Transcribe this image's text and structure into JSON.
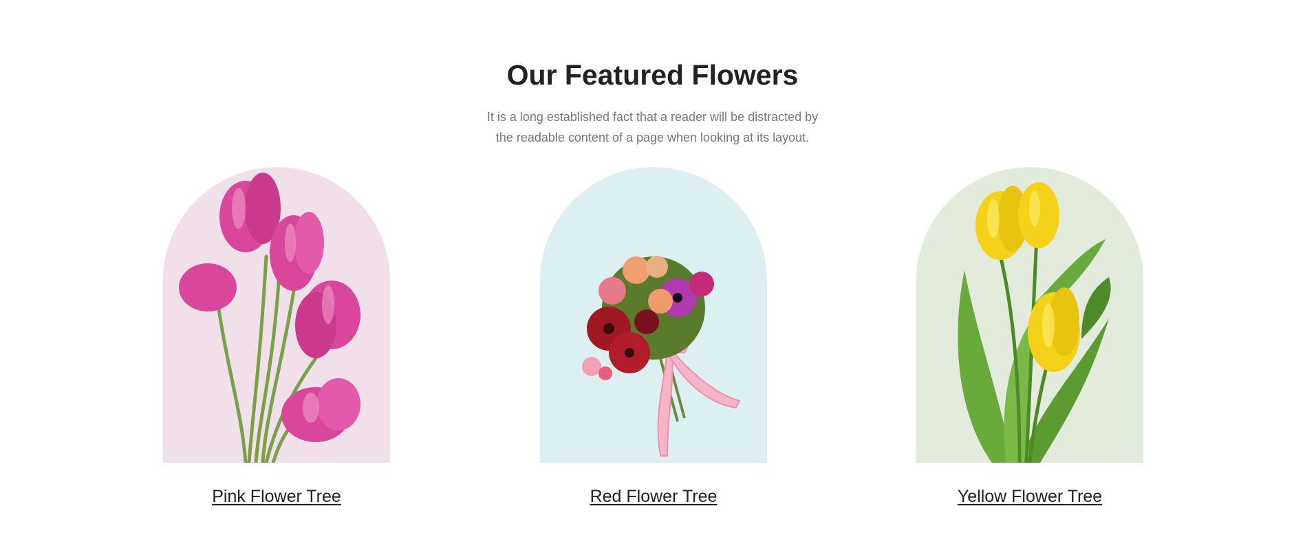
{
  "section": {
    "title": "Our Featured Flowers",
    "subtitle": "It is a long established fact that a reader will be distracted by the readable content of a page when looking at its layout."
  },
  "cards": [
    {
      "title": "Pink Flower Tree",
      "image": "pink-tulips-image",
      "bg_color": "#f1e0ea"
    },
    {
      "title": "Red Flower Tree",
      "image": "red-bouquet-image",
      "bg_color": "#dcf0f1"
    },
    {
      "title": "Yellow Flower Tree",
      "image": "yellow-tulips-image",
      "bg_color": "#e3ebdc"
    }
  ],
  "colors": {
    "heading": "#222222",
    "body_text": "#777777",
    "background": "#ffffff"
  }
}
